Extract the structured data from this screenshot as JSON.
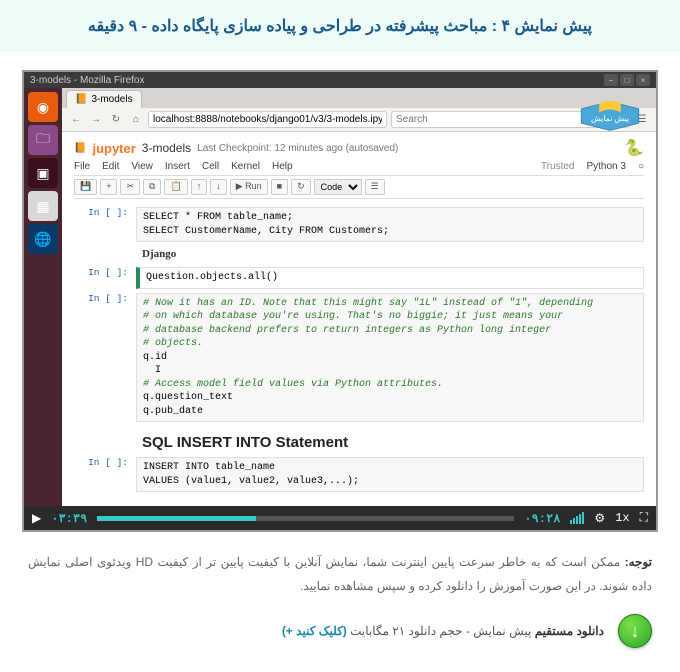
{
  "header": {
    "title": "پیش نمایش ۴ : مباحث پیشرفته در طراحی و پیاده سازی پایگاه داده - ۹ دقیقه"
  },
  "window": {
    "title": "3-models - Mozilla Firefox"
  },
  "browser": {
    "tab": "3-models",
    "url": "localhost:8888/notebooks/django01/v3/3-models.ipynb",
    "search_placeholder": "Search"
  },
  "badge_text": "پیش نمایش",
  "jupyter": {
    "logo": "jupyter",
    "name": "3-models",
    "checkpoint": "Last Checkpoint: 12 minutes ago (autosaved)",
    "menu": [
      "File",
      "Edit",
      "View",
      "Insert",
      "Cell",
      "Kernel",
      "Help"
    ],
    "trusted": "Trusted",
    "kernel": "Python 3",
    "toolbar": {
      "save": "💾",
      "add": "+",
      "cut": "✂",
      "copy": "⧉",
      "paste": "📋",
      "up": "↑",
      "down": "↓",
      "run": "▶ Run",
      "stop": "■",
      "restart": "↻",
      "celltype": "Code",
      "cmd": "☰"
    }
  },
  "cells": {
    "p": "In [ ]:",
    "c1": "SELECT * FROM table_name;\nSELECT CustomerName, City FROM Customers;",
    "django": "Django",
    "c2": "Question.objects.all()",
    "c3_cm1": "# Now it has an ID. Note that this might say \"1L\" instead of \"1\", depending\n# on which database you're using. That's no biggie; it just means your\n# database backend prefers to return integers as Python long integer\n# objects.",
    "c3_l1": "q.id",
    "c3_cm2": "# Access model field values via Python attributes.",
    "c3_l2": "q.question_text\nq.pub_date",
    "h3": "SQL INSERT INTO Statement",
    "c4": "INSERT INTO table_name\nVALUES (value1, value2, value3,...);"
  },
  "player": {
    "current": "۰۳:۳۹",
    "duration": "۰۹:۲۸",
    "speed": "1x"
  },
  "note": {
    "b": "توجه:",
    "text": " ممکن است که به خاطر سرعت پایین اینترنت شما، نمایش آنلاین با کیفیت پایین تر از کیفیت HD ویدئوی اصلی نمایش داده شوند. در این صورت آموزش را دانلود کرده و سپس مشاهده نمایید."
  },
  "download": {
    "b": "دانلود مستقیم",
    "mid": " پیش نمایش - حجم دانلود ۲۱ مگابایت ",
    "link": "(کلیک کنید +)"
  }
}
